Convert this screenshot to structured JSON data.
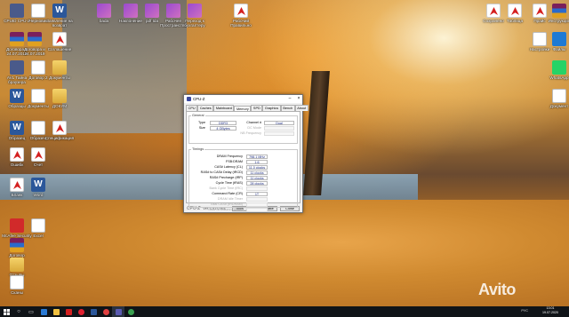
{
  "desktop": {
    "icons": [
      {
        "label": "CPUID CPU-Z",
        "kind": "chip"
      },
      {
        "label": "Договора и 24.07.2019",
        "kind": "rar"
      },
      {
        "label": "Договора и 24.07.2019",
        "kind": "rar"
      },
      {
        "label": "AVL Тайна браузера",
        "kind": "chip"
      },
      {
        "label": "Документы",
        "kind": "folder"
      },
      {
        "label": "Образцы",
        "kind": "word"
      },
      {
        "label": "Образец",
        "kind": "word"
      },
      {
        "label": "Образец",
        "kind": "doc"
      },
      {
        "label": "Ошибк",
        "kind": "pdf"
      },
      {
        "label": "Бланк",
        "kind": "pdf"
      },
      {
        "label": "McAfee Security Scan",
        "kind": "red"
      },
      {
        "label": "Черновик",
        "kind": "doc"
      },
      {
        "label": "Заявление на возврат",
        "kind": "word"
      },
      {
        "label": "Договор",
        "kind": "rar"
      },
      {
        "label": "Соглашение",
        "kind": "pdf"
      },
      {
        "label": "ДОКУМ",
        "kind": "folder"
      },
      {
        "label": "Договор 2",
        "kind": "doc"
      },
      {
        "label": "Документы",
        "kind": "doc"
      },
      {
        "label": "Отзывы",
        "kind": "folder"
      },
      {
        "label": "Сканы",
        "kind": "doc"
      },
      {
        "label": "Спецификация",
        "kind": "pdf"
      },
      {
        "label": "Счет",
        "kind": "pdf"
      },
      {
        "label": "Word",
        "kind": "word"
      },
      {
        "label": "Excel",
        "kind": "doc"
      },
      {
        "label": "bada",
        "kind": "winrar2"
      },
      {
        "label": "Наклонение",
        "kind": "winrar2"
      },
      {
        "label": "pdf tda",
        "kind": "winrar2"
      },
      {
        "label": "Рабочее Пространство",
        "kind": "winrar2"
      },
      {
        "label": "Переход к бухгалтеру",
        "kind": "winrar2"
      },
      {
        "label": "Рабочий Правильно",
        "kind": "pdf"
      },
      {
        "label": "Сохранено",
        "kind": "pdf"
      },
      {
        "label": "Таблица",
        "kind": "pdf"
      },
      {
        "label": "Прайс",
        "kind": "pdf"
      },
      {
        "label": "Инструкция",
        "kind": "rar"
      },
      {
        "label": "Настройки",
        "kind": "doc"
      },
      {
        "label": "Файлы",
        "kind": "blue"
      },
      {
        "label": "WhatsApp",
        "kind": "green"
      },
      {
        "label": "Документ",
        "kind": "doc"
      }
    ]
  },
  "cpuz": {
    "title": "CPU-Z",
    "tabs": [
      "CPU",
      "Caches",
      "Mainboard",
      "Memory",
      "SPD",
      "Graphics",
      "Bench",
      "About"
    ],
    "active_tab": "Memory",
    "general": {
      "group_title": "General",
      "type_label": "Type",
      "type_value": "DDR3",
      "size_label": "Size",
      "size_value": "4 GBytes",
      "channel_label": "Channel #",
      "channel_value": "Dual",
      "dcmode_label": "DC Mode",
      "dcmode_value": "",
      "nbfreq_label": "NB Frequency",
      "nbfreq_value": ""
    },
    "timings": {
      "group_title": "Timings",
      "rows": [
        {
          "label": "DRAM Frequency",
          "value": "798.1 MHz",
          "enabled": true
        },
        {
          "label": "FSB:DRAM",
          "value": "1:6",
          "enabled": true
        },
        {
          "label": "CAS# Latency (CL)",
          "value": "11.0 clocks",
          "enabled": true
        },
        {
          "label": "RAS# to CAS# Delay (tRCD)",
          "value": "11 clocks",
          "enabled": true
        },
        {
          "label": "RAS# Precharge (tRP)",
          "value": "11 clocks",
          "enabled": true
        },
        {
          "label": "Cycle Time (tRAS)",
          "value": "28 clocks",
          "enabled": true
        },
        {
          "label": "Bank Cycle Time (tRC)",
          "value": "",
          "enabled": false
        },
        {
          "label": "Command Rate (CR)",
          "value": "1T",
          "enabled": true
        },
        {
          "label": "DRAM Idle Timer",
          "value": "",
          "enabled": false
        },
        {
          "label": "Total CAS# (tRDRAM)",
          "value": "",
          "enabled": false
        },
        {
          "label": "Row To Column (tRCD)",
          "value": "",
          "enabled": false
        }
      ]
    },
    "footer": {
      "brand": "CPU-Z",
      "version": "Ver. 1.91.0.x64",
      "tools_label": "Tools",
      "validate_label": "Validate",
      "close_label": "Close"
    }
  },
  "taskbar": {
    "tray_text": "РУС",
    "time": "13:01",
    "date": "19.07.2020"
  },
  "watermark": "Avito"
}
